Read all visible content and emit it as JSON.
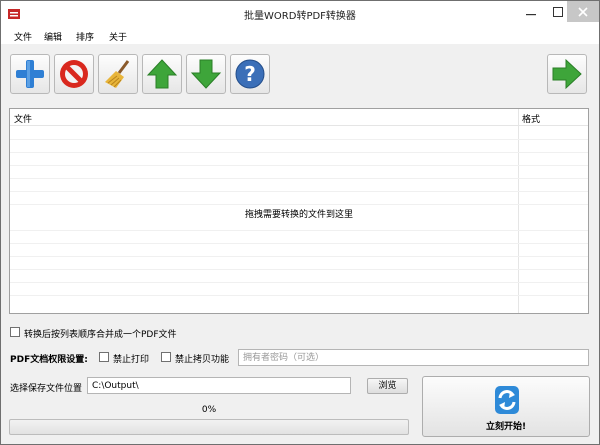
{
  "window": {
    "title": "批量WORD转PDF转换器"
  },
  "menu": {
    "items": [
      "文件",
      "编辑",
      "排序",
      "关于"
    ]
  },
  "toolbar": {
    "buttons": [
      {
        "icon": "add-icon"
      },
      {
        "icon": "remove-icon"
      },
      {
        "icon": "broom-icon"
      },
      {
        "icon": "arrow-up-icon"
      },
      {
        "icon": "arrow-down-icon"
      },
      {
        "icon": "help-icon"
      }
    ],
    "next_icon": "arrow-right-icon"
  },
  "file_list": {
    "columns": [
      "文件",
      "格式"
    ],
    "drop_hint": "拖拽需要转换的文件到这里"
  },
  "merge_option": {
    "label": "转换后按列表顺序合并成一个PDF文件",
    "checked": false
  },
  "pdf_permissions": {
    "label": "PDF文档权限设置:",
    "no_print_label": "禁止打印",
    "no_print_checked": false,
    "no_copy_label": "禁止拷贝功能",
    "no_copy_checked": false,
    "password_placeholder": "拥有者密码（可选）",
    "password_value": ""
  },
  "output": {
    "label": "选择保存文件位置",
    "path": "C:\\Output\\",
    "browse_label": "浏览"
  },
  "progress": {
    "percent_text": "0%",
    "value": 0
  },
  "start_button": {
    "label": "立刻开始!"
  },
  "colors": {
    "plus_blue": "#2f7fd4",
    "stop_red": "#d9281e",
    "arrow_green": "#3ea53a",
    "help_blue": "#3b6fb8",
    "refresh_blue": "#2e8ad8"
  }
}
